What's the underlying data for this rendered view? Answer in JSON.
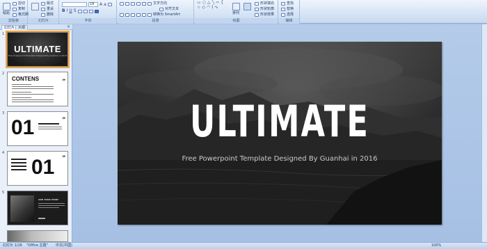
{
  "ribbon": {
    "groups": [
      {
        "label": "剪贴板",
        "paste": "粘贴",
        "items": [
          "剪切",
          "复制",
          "格式刷"
        ]
      },
      {
        "label": "幻灯片",
        "new_slide": "新建\n幻灯片",
        "items": [
          "版式",
          "重设",
          "删除"
        ]
      },
      {
        "label": "字体",
        "font_size": "18"
      },
      {
        "label": "段落",
        "items": [
          "文字方向",
          "对齐文本",
          "转换为 SmartArt"
        ]
      },
      {
        "label": "绘图",
        "arrange": "排列",
        "quick_styles": "快速样式",
        "items": [
          "形状填充",
          "形状轮廓",
          "形状效果"
        ]
      },
      {
        "label": "编辑",
        "items": [
          "查找",
          "替换",
          "选择"
        ]
      }
    ]
  },
  "pane": {
    "tabs": [
      "幻灯片",
      "大纲"
    ],
    "close": "×",
    "thumbs": [
      {
        "num": "1",
        "title": "ULTIMATE",
        "sub": "Free Powerpoint Template Designed By Guanhai in 2016"
      },
      {
        "num": "2",
        "title": "CONTENS"
      },
      {
        "num": "3",
        "title": "01"
      },
      {
        "num": "4",
        "title": "01"
      },
      {
        "num": "5",
        "title": "ADD YOUR POINT"
      }
    ]
  },
  "slide": {
    "title": "ULTIMATE",
    "subtitle": "Free Powerpoint Template Designed By Guanhai in 2016"
  },
  "status": {
    "slide_info": "幻灯片 1/16",
    "theme": "\"Office 主题\"",
    "language": "中文(中国)",
    "zoom": "100%"
  },
  "colors": {
    "ribbon_bg": "#d6e4f6",
    "workspace_bg": "#a6c0e4",
    "active_outline": "#f4a53a"
  }
}
